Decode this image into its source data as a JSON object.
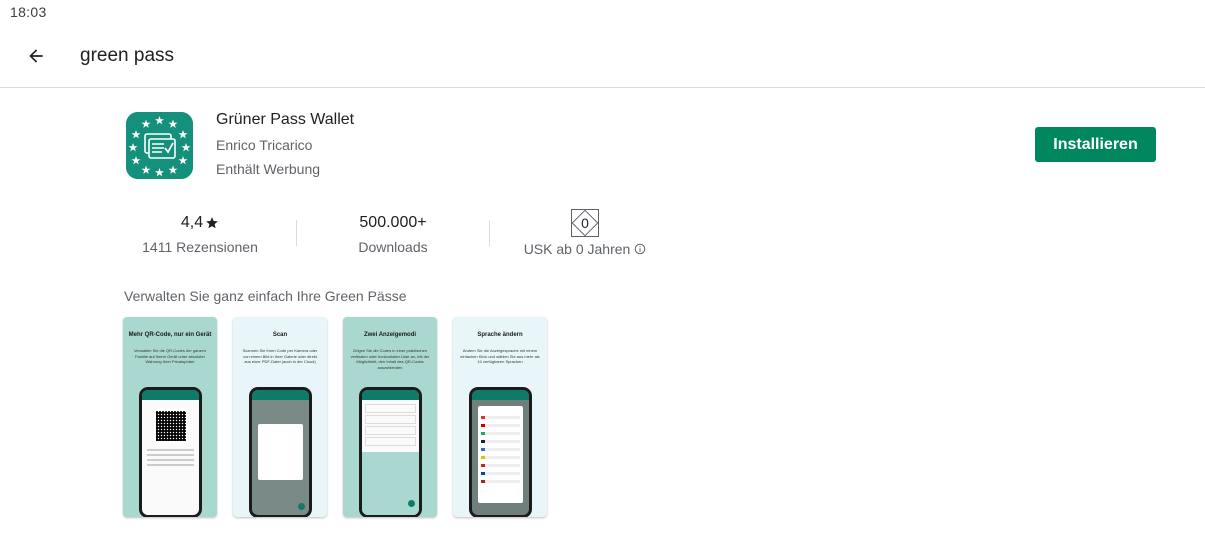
{
  "status_bar": {
    "time": "18:03"
  },
  "search": {
    "query": "green pass"
  },
  "app": {
    "title": "Grüner Pass Wallet",
    "developer": "Enrico Tricarico",
    "ads_notice": "Enthält Werbung",
    "install_label": "Installieren",
    "accent_color": "#01875f",
    "icon_color": "#15907c"
  },
  "stats": {
    "rating": "4,4",
    "rating_icon": "star-icon",
    "reviews_label": "1411 Rezensionen",
    "downloads": "500.000+",
    "downloads_label": "Downloads",
    "age_badge": "0",
    "age_label": "USK ab 0 Jahren",
    "age_info_icon": "info-icon"
  },
  "description": "Verwalten Sie ganz einfach Ihre Green Pässe",
  "screenshots": [
    {
      "title": "Mehr QR-Code, nur ein Gerät",
      "text": "Verwalten Sie die QR-Codes der ganzen Familie auf Ihrem Gerät unter absoluter Wahrung Ihrer Privatsphäre"
    },
    {
      "title": "Scan",
      "text": "Scannen Sie Ihren Code per Kamera oder von einem Bild in Ihrer Galerie oder direkt aus einer PDF-Datei (auch in der Cloud)"
    },
    {
      "title": "Zwei Anzeigemodi",
      "text": "Zeigen Sie die Codes in einer praktischen vertikalen oder horizontalen Liste an, mit der Möglichkeit, den Inhalt des QR-Codes auszublenden"
    },
    {
      "title": "Sprache ändern",
      "text": "Ändern Sie die Anzeigesprache mit einem einfachen Klick und wählen Sie aus mehr als 10 verfügbaren Sprachen"
    }
  ]
}
